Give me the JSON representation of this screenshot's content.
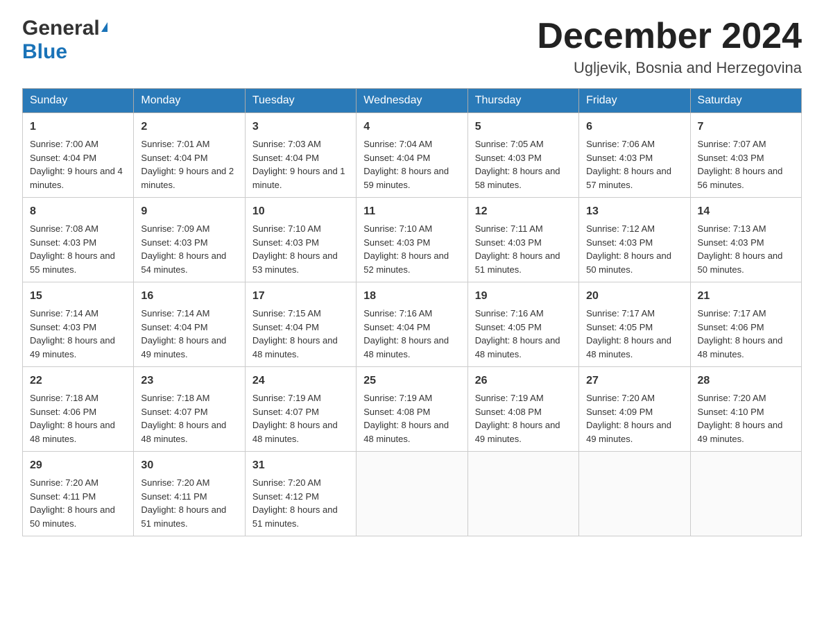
{
  "header": {
    "logo_general": "General",
    "logo_blue": "Blue",
    "month_title": "December 2024",
    "location": "Ugljevik, Bosnia and Herzegovina"
  },
  "weekdays": [
    "Sunday",
    "Monday",
    "Tuesday",
    "Wednesday",
    "Thursday",
    "Friday",
    "Saturday"
  ],
  "weeks": [
    [
      {
        "day": "1",
        "sunrise": "7:00 AM",
        "sunset": "4:04 PM",
        "daylight": "9 hours and 4 minutes."
      },
      {
        "day": "2",
        "sunrise": "7:01 AM",
        "sunset": "4:04 PM",
        "daylight": "9 hours and 2 minutes."
      },
      {
        "day": "3",
        "sunrise": "7:03 AM",
        "sunset": "4:04 PM",
        "daylight": "9 hours and 1 minute."
      },
      {
        "day": "4",
        "sunrise": "7:04 AM",
        "sunset": "4:04 PM",
        "daylight": "8 hours and 59 minutes."
      },
      {
        "day": "5",
        "sunrise": "7:05 AM",
        "sunset": "4:03 PM",
        "daylight": "8 hours and 58 minutes."
      },
      {
        "day": "6",
        "sunrise": "7:06 AM",
        "sunset": "4:03 PM",
        "daylight": "8 hours and 57 minutes."
      },
      {
        "day": "7",
        "sunrise": "7:07 AM",
        "sunset": "4:03 PM",
        "daylight": "8 hours and 56 minutes."
      }
    ],
    [
      {
        "day": "8",
        "sunrise": "7:08 AM",
        "sunset": "4:03 PM",
        "daylight": "8 hours and 55 minutes."
      },
      {
        "day": "9",
        "sunrise": "7:09 AM",
        "sunset": "4:03 PM",
        "daylight": "8 hours and 54 minutes."
      },
      {
        "day": "10",
        "sunrise": "7:10 AM",
        "sunset": "4:03 PM",
        "daylight": "8 hours and 53 minutes."
      },
      {
        "day": "11",
        "sunrise": "7:10 AM",
        "sunset": "4:03 PM",
        "daylight": "8 hours and 52 minutes."
      },
      {
        "day": "12",
        "sunrise": "7:11 AM",
        "sunset": "4:03 PM",
        "daylight": "8 hours and 51 minutes."
      },
      {
        "day": "13",
        "sunrise": "7:12 AM",
        "sunset": "4:03 PM",
        "daylight": "8 hours and 50 minutes."
      },
      {
        "day": "14",
        "sunrise": "7:13 AM",
        "sunset": "4:03 PM",
        "daylight": "8 hours and 50 minutes."
      }
    ],
    [
      {
        "day": "15",
        "sunrise": "7:14 AM",
        "sunset": "4:03 PM",
        "daylight": "8 hours and 49 minutes."
      },
      {
        "day": "16",
        "sunrise": "7:14 AM",
        "sunset": "4:04 PM",
        "daylight": "8 hours and 49 minutes."
      },
      {
        "day": "17",
        "sunrise": "7:15 AM",
        "sunset": "4:04 PM",
        "daylight": "8 hours and 48 minutes."
      },
      {
        "day": "18",
        "sunrise": "7:16 AM",
        "sunset": "4:04 PM",
        "daylight": "8 hours and 48 minutes."
      },
      {
        "day": "19",
        "sunrise": "7:16 AM",
        "sunset": "4:05 PM",
        "daylight": "8 hours and 48 minutes."
      },
      {
        "day": "20",
        "sunrise": "7:17 AM",
        "sunset": "4:05 PM",
        "daylight": "8 hours and 48 minutes."
      },
      {
        "day": "21",
        "sunrise": "7:17 AM",
        "sunset": "4:06 PM",
        "daylight": "8 hours and 48 minutes."
      }
    ],
    [
      {
        "day": "22",
        "sunrise": "7:18 AM",
        "sunset": "4:06 PM",
        "daylight": "8 hours and 48 minutes."
      },
      {
        "day": "23",
        "sunrise": "7:18 AM",
        "sunset": "4:07 PM",
        "daylight": "8 hours and 48 minutes."
      },
      {
        "day": "24",
        "sunrise": "7:19 AM",
        "sunset": "4:07 PM",
        "daylight": "8 hours and 48 minutes."
      },
      {
        "day": "25",
        "sunrise": "7:19 AM",
        "sunset": "4:08 PM",
        "daylight": "8 hours and 48 minutes."
      },
      {
        "day": "26",
        "sunrise": "7:19 AM",
        "sunset": "4:08 PM",
        "daylight": "8 hours and 49 minutes."
      },
      {
        "day": "27",
        "sunrise": "7:20 AM",
        "sunset": "4:09 PM",
        "daylight": "8 hours and 49 minutes."
      },
      {
        "day": "28",
        "sunrise": "7:20 AM",
        "sunset": "4:10 PM",
        "daylight": "8 hours and 49 minutes."
      }
    ],
    [
      {
        "day": "29",
        "sunrise": "7:20 AM",
        "sunset": "4:11 PM",
        "daylight": "8 hours and 50 minutes."
      },
      {
        "day": "30",
        "sunrise": "7:20 AM",
        "sunset": "4:11 PM",
        "daylight": "8 hours and 51 minutes."
      },
      {
        "day": "31",
        "sunrise": "7:20 AM",
        "sunset": "4:12 PM",
        "daylight": "8 hours and 51 minutes."
      },
      null,
      null,
      null,
      null
    ]
  ],
  "labels": {
    "sunrise": "Sunrise:",
    "sunset": "Sunset:",
    "daylight": "Daylight:"
  }
}
